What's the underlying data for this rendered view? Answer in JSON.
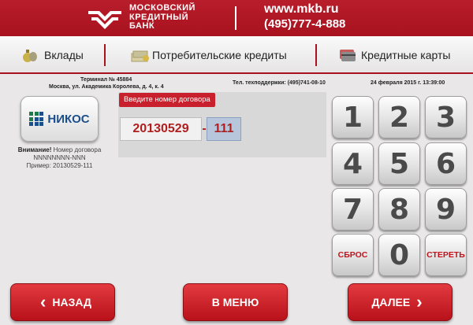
{
  "header": {
    "logo_lines": [
      "МОСКОВСКИЙ",
      "КРЕДИТНЫЙ",
      "БАНК"
    ],
    "url": "www.mkb.ru",
    "phone": "(495)777-4-888",
    "brand_color": "#b81d2a"
  },
  "nav": [
    {
      "label": "Вклады",
      "icon": "money-bag-icon"
    },
    {
      "label": "Потребительские кредиты",
      "icon": "cash-stack-icon"
    },
    {
      "label": "Кредитные карты",
      "icon": "cards-icon"
    }
  ],
  "info": {
    "terminal": "Терминал № 45884",
    "address": "Москва, ул. Академика Королева, д. 4, к. 4",
    "support": "Тел. техподдержки: (495)741-08-10",
    "datetime": "24 февраля 2015 г. 13:39:00"
  },
  "provider": {
    "name": "НИКОС",
    "note_label": "Внимание!",
    "note_text": "Номер договора",
    "note_format": "NNNNNNNN-NNN",
    "note_example": "Пример: 20130529-111"
  },
  "input": {
    "prompt": "Введите номер договора",
    "part1": "20130529",
    "separator": "-",
    "part2": "111"
  },
  "keypad": {
    "keys": [
      "1",
      "2",
      "3",
      "4",
      "5",
      "6",
      "7",
      "8",
      "9",
      "СБРОС",
      "0",
      "СТЕРЕТЬ"
    ]
  },
  "footer": {
    "back": "НАЗАД",
    "menu": "В МЕНЮ",
    "next": "ДАЛЕЕ"
  }
}
